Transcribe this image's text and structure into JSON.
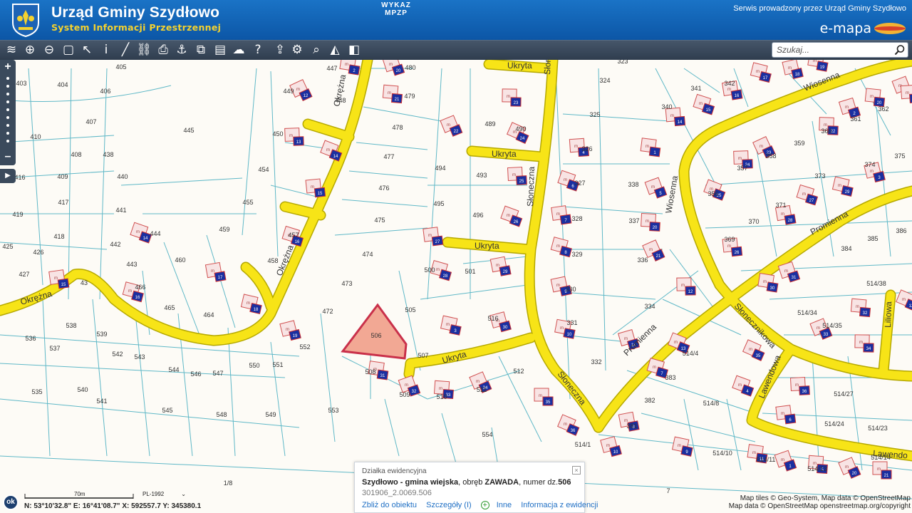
{
  "header": {
    "title": "Urząd Gminy Szydłowo",
    "subtitle": "System Informacji Przestrzennej",
    "service_note": "Serwis prowadzony przez Urząd Gminy Szydłowo",
    "logo_text": "e-mapa"
  },
  "toolbar": {
    "tools": [
      "layers-icon",
      "zoom-in-icon",
      "zoom-out-icon",
      "zoom-extent-icon",
      "select-pointer-icon",
      "info-icon",
      "measure-line-icon",
      "measure-chain-icon",
      "print-icon",
      "anchor-icon",
      "copy-icon",
      "layout-icon",
      "cloud-icon",
      "help-icon",
      "upload-icon",
      "settings-icon",
      "search-map-icon",
      "road-icon",
      "shapes-icon"
    ],
    "wykaz_label_1": "WYKAZ",
    "wykaz_label_2": "MPZP"
  },
  "search": {
    "placeholder": "Szukaj..."
  },
  "colors": {
    "road": "#f7e417",
    "road_edge": "#b5a800",
    "parcel_line": "#5fb8c7",
    "building_fill": "#f8e4e4",
    "building_edge": "#d05050",
    "selected_fill": "#f2a894",
    "selected_edge": "#c9304a",
    "house_badge": "#1a2fa0"
  },
  "map": {
    "parcels": [
      "405",
      "403",
      "404",
      "406",
      "407",
      "410",
      "408",
      "438",
      "440",
      "441",
      "442",
      "443",
      "445",
      "444",
      "449",
      "448",
      "447",
      "450",
      "454",
      "455",
      "459",
      "460",
      "457",
      "458",
      "464",
      "465",
      "466",
      "472",
      "473",
      "474",
      "475",
      "476",
      "477",
      "478",
      "479",
      "480",
      "489",
      "490",
      "493",
      "494",
      "495",
      "496",
      "500",
      "501",
      "505",
      "506",
      "507",
      "508",
      "509",
      "510",
      "511",
      "512",
      "516",
      "552",
      "551",
      "550",
      "547",
      "546",
      "544",
      "543",
      "542",
      "541",
      "540",
      "539",
      "538",
      "537",
      "536",
      "535",
      "545",
      "548",
      "549",
      "553",
      "554",
      "416",
      "409",
      "417",
      "419",
      "418",
      "426",
      "425",
      "427",
      "43",
      "1/8",
      "7",
      "323",
      "324",
      "325",
      "326",
      "327",
      "328",
      "329",
      "330",
      "331",
      "332",
      "336",
      "337",
      "338",
      "340",
      "341",
      "342",
      "357",
      "358",
      "359",
      "360",
      "361",
      "362",
      "371",
      "373",
      "374",
      "375",
      "370",
      "356",
      "369",
      "384",
      "385",
      "386",
      "383",
      "382",
      "381",
      "334",
      "514/38",
      "514/34",
      "514/35",
      "514/4",
      "514/27",
      "514/24",
      "514/23",
      "514/8",
      "514/10",
      "514/11",
      "514/13",
      "514/1",
      "514/14"
    ],
    "streets": [
      "Okrężna",
      "Okrężna",
      "Okrężna",
      "Ukryta",
      "Ukryta",
      "Ukryta",
      "Ukryta",
      "Słoneczna",
      "Słoneczna",
      "Słoneczna",
      "Wiosenna",
      "Wiosenna",
      "Promienna",
      "Promienna",
      "Słonecznikowa",
      "Lawendowa",
      "Liliowa",
      "Lawendo"
    ],
    "building_letter": "m",
    "house_numbers": [
      "12",
      "13",
      "14",
      "15",
      "16",
      "17",
      "18",
      "19",
      "2",
      "20",
      "21",
      "22",
      "23",
      "24",
      "25",
      "26",
      "27",
      "28",
      "29",
      "3",
      "30",
      "31",
      "32",
      "33",
      "34",
      "35",
      "36",
      "4",
      "6",
      "7",
      "8",
      "9",
      "10",
      "11",
      "1",
      "5",
      "20",
      "21"
    ],
    "selected_parcel": "506"
  },
  "popup": {
    "heading": "Działka ewidencyjna",
    "gmina": "Szydłowo - gmina wiejska",
    "obreb_prefix": ", obręb ",
    "obreb": "ZAWADA",
    "numer_prefix": ", numer dz.",
    "numer": "506",
    "code": "301906_2.0069.506",
    "link_zoom": "Zbliż do obiektu",
    "link_details": "Szczegóły (I)",
    "link_other": "Inne",
    "link_registry": "Informacja z ewidencji",
    "close_glyph": "×"
  },
  "status": {
    "ok_label": "ok",
    "scale": "70m",
    "crs": "PL-1992",
    "coords": "N: 53°10'32.8\" E: 16°41'08.7\" X: 592557.7  Y: 345380.1"
  },
  "attribution": {
    "line1": "Map tiles © Geo-System, Map data © OpenStreetMap",
    "line2": "Map data © OpenStreetMap openstreetmap.org/copyright"
  }
}
